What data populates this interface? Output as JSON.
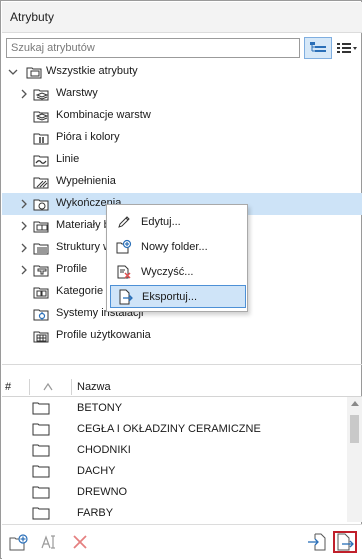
{
  "window": {
    "title": "Atrybuty"
  },
  "search": {
    "placeholder": "Szukaj atrybutów",
    "value": ""
  },
  "toolbar": {
    "tree_view_icon": "tree-view-icon",
    "list_view_icon": "list-view-icon"
  },
  "tree": {
    "root": {
      "label": "Wszystkie atrybuty",
      "icon": "folder-stack-icon",
      "expanded": true
    },
    "items": [
      {
        "label": "Warstwy",
        "icon": "layers-icon",
        "expandable": true
      },
      {
        "label": "Kombinacje warstw",
        "icon": "layer-combinations-icon",
        "expandable": false
      },
      {
        "label": "Pióra i kolory",
        "icon": "pens-icon",
        "expandable": false
      },
      {
        "label": "Linie",
        "icon": "line-types-icon",
        "expandable": false
      },
      {
        "label": "Wypełnienia",
        "icon": "fills-icon",
        "expandable": false
      },
      {
        "label": "Wykończenia",
        "icon": "surfaces-icon",
        "expandable": true,
        "selected": true
      },
      {
        "label": "Materiały budowlane",
        "icon": "building-materials-icon",
        "expandable": true
      },
      {
        "label": "Struktury warstwowe",
        "icon": "composites-icon",
        "expandable": true
      },
      {
        "label": "Profile",
        "icon": "profiles-icon",
        "expandable": true
      },
      {
        "label": "Kategorie stref",
        "icon": "zone-categories-icon",
        "expandable": false
      },
      {
        "label": "Systemy instalacji",
        "icon": "mep-systems-icon",
        "expandable": false
      },
      {
        "label": "Profile użytkowania",
        "icon": "operation-profiles-icon",
        "expandable": false
      }
    ]
  },
  "context_menu": {
    "items": [
      {
        "label": "Edytuj...",
        "icon": "pencil-icon"
      },
      {
        "label": "Nowy folder...",
        "icon": "new-folder-icon"
      },
      {
        "label": "Wyczyść...",
        "icon": "purge-icon"
      },
      {
        "label": "Eksportuj...",
        "icon": "export-icon",
        "active": true
      }
    ]
  },
  "table": {
    "columns": {
      "index": "#",
      "sort": "sort-ascending-icon",
      "name": "Nazwa"
    },
    "rows": [
      {
        "name": "BETONY"
      },
      {
        "name": "CEGŁA I OKŁADZINY CERAMICZNE"
      },
      {
        "name": "CHODNIKI"
      },
      {
        "name": "DACHY"
      },
      {
        "name": "DREWNO"
      },
      {
        "name": "FARBY"
      }
    ]
  },
  "bottom_bar": {
    "buttons": [
      "new-folder-icon",
      "rename-icon",
      "delete-icon",
      "import-icon",
      "export-icon"
    ]
  },
  "colors": {
    "selection": "#cde3f7",
    "accent_border": "#4d90d6",
    "highlight_red": "#c0202b",
    "delete_red": "#e05050"
  }
}
